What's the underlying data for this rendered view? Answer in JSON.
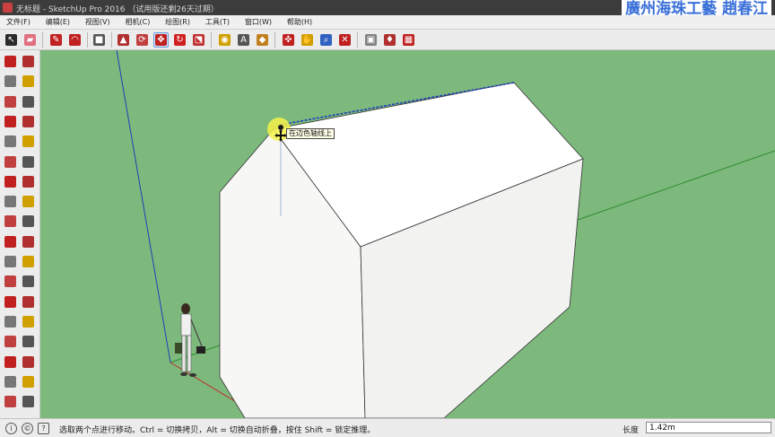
{
  "window": {
    "title": "无标题 - SketchUp Pro 2016 （试用版还剩26天过期）",
    "watermark": "廣州海珠工藝 趙春江"
  },
  "menu": [
    "文件(F)",
    "编辑(E)",
    "视图(V)",
    "相机(C)",
    "绘图(R)",
    "工具(T)",
    "窗口(W)",
    "帮助(H)"
  ],
  "toolbar": {
    "tools": [
      {
        "name": "select-icon",
        "color": "#2b2b2b",
        "glyph": "↖"
      },
      {
        "name": "eraser-icon",
        "color": "#e07080",
        "glyph": "▰"
      },
      {
        "name": "pencil-icon",
        "color": "#c02020",
        "glyph": "✎"
      },
      {
        "name": "arc-icon",
        "color": "#c02020",
        "glyph": "◠"
      },
      {
        "name": "rectangle-icon",
        "color": "#555555",
        "glyph": "■"
      },
      {
        "name": "pushpull-icon",
        "color": "#b03030",
        "glyph": "▲"
      },
      {
        "name": "offset-icon",
        "color": "#c04040",
        "glyph": "⟳"
      },
      {
        "name": "move-icon",
        "color": "#c02020",
        "glyph": "✥"
      },
      {
        "name": "rotate-icon",
        "color": "#d02020",
        "glyph": "↻"
      },
      {
        "name": "scale-icon",
        "color": "#c03030",
        "glyph": "⬔"
      },
      {
        "name": "tape-measure-icon",
        "color": "#d0a000",
        "glyph": "◉"
      },
      {
        "name": "text-icon",
        "color": "#555555",
        "glyph": "A"
      },
      {
        "name": "paint-bucket-icon",
        "color": "#c08020",
        "glyph": "◆"
      },
      {
        "name": "orbit-icon",
        "color": "#c02020",
        "glyph": "✜"
      },
      {
        "name": "pan-icon",
        "color": "#d0a000",
        "glyph": "✋"
      },
      {
        "name": "zoom-icon",
        "color": "#3060c0",
        "glyph": "⌕"
      },
      {
        "name": "zoom-extents-icon",
        "color": "#c02020",
        "glyph": "✕"
      },
      {
        "name": "warehouse-icon",
        "color": "#808080",
        "glyph": "▣"
      },
      {
        "name": "extension-icon",
        "color": "#b03030",
        "glyph": "♦"
      },
      {
        "name": "layout-icon",
        "color": "#c02020",
        "glyph": "▦"
      }
    ]
  },
  "sidebar": {
    "tools": [
      "select-icon",
      "component-icon",
      "paint-bucket-icon",
      "eraser-icon",
      "line-icon",
      "freehand-icon",
      "rectangle-icon",
      "rotated-rectangle-icon",
      "circle-icon",
      "polygon-icon",
      "arc-icon",
      "pie-icon",
      "two-point-arc-icon",
      "three-point-arc-icon",
      "move-icon",
      "pushpull-icon",
      "rotate-icon",
      "followme-icon",
      "scale-icon",
      "offset-icon",
      "tape-measure-icon",
      "dimension-icon",
      "protractor-icon",
      "text-icon",
      "axes-icon",
      "3d-text-icon",
      "orbit-icon",
      "pan-icon",
      "zoom-icon",
      "zoom-window-icon",
      "zoom-extents-icon",
      "previous-view-icon",
      "position-camera-icon",
      "walk-icon",
      "section-plane-icon",
      "look-around-icon"
    ]
  },
  "viewport": {
    "tooltip": "在边色轴线上",
    "colors": {
      "background": "#7db97c",
      "face_light": "#ffffff",
      "face_side": "#f2f2f0",
      "red_axis": "#c03030",
      "green_axis": "#2f8c2f",
      "blue_axis": "#1e3fb8",
      "inference_point": "#f4f24a"
    }
  },
  "status": {
    "text": "选取两个点进行移动。Ctrl = 切换拷贝，Alt = 切换自动折叠，按住 Shift = 锁定推理。",
    "vcb_label": "长度",
    "vcb_value": "1.42m"
  }
}
